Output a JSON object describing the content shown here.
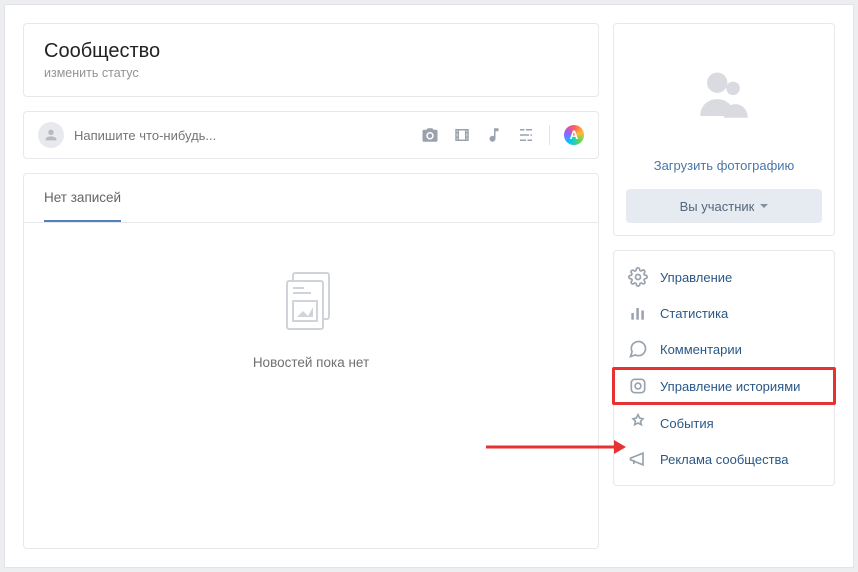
{
  "header": {
    "title": "Сообщество",
    "subtitle": "изменить статус"
  },
  "composer": {
    "placeholder": "Напишите что-нибудь..."
  },
  "posts": {
    "tab_label": "Нет записей",
    "empty_text": "Новостей пока нет"
  },
  "side": {
    "upload_label": "Загрузить фотографию",
    "member_btn": "Вы участник"
  },
  "menu": {
    "items": [
      {
        "label": "Управление"
      },
      {
        "label": "Статистика"
      },
      {
        "label": "Комментарии"
      },
      {
        "label": "Управление историями"
      },
      {
        "label": "События"
      },
      {
        "label": "Реклама сообщества"
      }
    ]
  }
}
